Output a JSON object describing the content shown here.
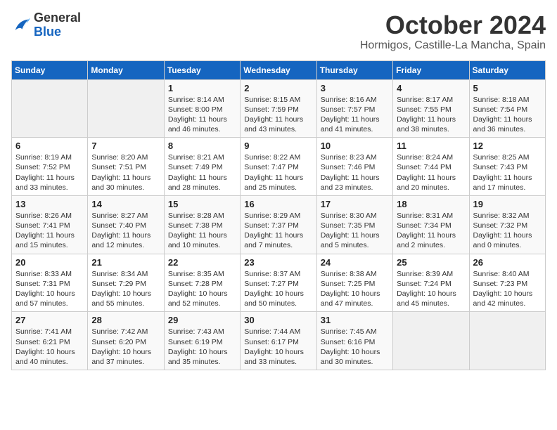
{
  "logo": {
    "general": "General",
    "blue": "Blue"
  },
  "title": "October 2024",
  "location": "Hormigos, Castille-La Mancha, Spain",
  "days_of_week": [
    "Sunday",
    "Monday",
    "Tuesday",
    "Wednesday",
    "Thursday",
    "Friday",
    "Saturday"
  ],
  "weeks": [
    [
      {
        "day": "",
        "info": ""
      },
      {
        "day": "",
        "info": ""
      },
      {
        "day": "1",
        "info": "Sunrise: 8:14 AM\nSunset: 8:00 PM\nDaylight: 11 hours and 46 minutes."
      },
      {
        "day": "2",
        "info": "Sunrise: 8:15 AM\nSunset: 7:59 PM\nDaylight: 11 hours and 43 minutes."
      },
      {
        "day": "3",
        "info": "Sunrise: 8:16 AM\nSunset: 7:57 PM\nDaylight: 11 hours and 41 minutes."
      },
      {
        "day": "4",
        "info": "Sunrise: 8:17 AM\nSunset: 7:55 PM\nDaylight: 11 hours and 38 minutes."
      },
      {
        "day": "5",
        "info": "Sunrise: 8:18 AM\nSunset: 7:54 PM\nDaylight: 11 hours and 36 minutes."
      }
    ],
    [
      {
        "day": "6",
        "info": "Sunrise: 8:19 AM\nSunset: 7:52 PM\nDaylight: 11 hours and 33 minutes."
      },
      {
        "day": "7",
        "info": "Sunrise: 8:20 AM\nSunset: 7:51 PM\nDaylight: 11 hours and 30 minutes."
      },
      {
        "day": "8",
        "info": "Sunrise: 8:21 AM\nSunset: 7:49 PM\nDaylight: 11 hours and 28 minutes."
      },
      {
        "day": "9",
        "info": "Sunrise: 8:22 AM\nSunset: 7:47 PM\nDaylight: 11 hours and 25 minutes."
      },
      {
        "day": "10",
        "info": "Sunrise: 8:23 AM\nSunset: 7:46 PM\nDaylight: 11 hours and 23 minutes."
      },
      {
        "day": "11",
        "info": "Sunrise: 8:24 AM\nSunset: 7:44 PM\nDaylight: 11 hours and 20 minutes."
      },
      {
        "day": "12",
        "info": "Sunrise: 8:25 AM\nSunset: 7:43 PM\nDaylight: 11 hours and 17 minutes."
      }
    ],
    [
      {
        "day": "13",
        "info": "Sunrise: 8:26 AM\nSunset: 7:41 PM\nDaylight: 11 hours and 15 minutes."
      },
      {
        "day": "14",
        "info": "Sunrise: 8:27 AM\nSunset: 7:40 PM\nDaylight: 11 hours and 12 minutes."
      },
      {
        "day": "15",
        "info": "Sunrise: 8:28 AM\nSunset: 7:38 PM\nDaylight: 11 hours and 10 minutes."
      },
      {
        "day": "16",
        "info": "Sunrise: 8:29 AM\nSunset: 7:37 PM\nDaylight: 11 hours and 7 minutes."
      },
      {
        "day": "17",
        "info": "Sunrise: 8:30 AM\nSunset: 7:35 PM\nDaylight: 11 hours and 5 minutes."
      },
      {
        "day": "18",
        "info": "Sunrise: 8:31 AM\nSunset: 7:34 PM\nDaylight: 11 hours and 2 minutes."
      },
      {
        "day": "19",
        "info": "Sunrise: 8:32 AM\nSunset: 7:32 PM\nDaylight: 11 hours and 0 minutes."
      }
    ],
    [
      {
        "day": "20",
        "info": "Sunrise: 8:33 AM\nSunset: 7:31 PM\nDaylight: 10 hours and 57 minutes."
      },
      {
        "day": "21",
        "info": "Sunrise: 8:34 AM\nSunset: 7:29 PM\nDaylight: 10 hours and 55 minutes."
      },
      {
        "day": "22",
        "info": "Sunrise: 8:35 AM\nSunset: 7:28 PM\nDaylight: 10 hours and 52 minutes."
      },
      {
        "day": "23",
        "info": "Sunrise: 8:37 AM\nSunset: 7:27 PM\nDaylight: 10 hours and 50 minutes."
      },
      {
        "day": "24",
        "info": "Sunrise: 8:38 AM\nSunset: 7:25 PM\nDaylight: 10 hours and 47 minutes."
      },
      {
        "day": "25",
        "info": "Sunrise: 8:39 AM\nSunset: 7:24 PM\nDaylight: 10 hours and 45 minutes."
      },
      {
        "day": "26",
        "info": "Sunrise: 8:40 AM\nSunset: 7:23 PM\nDaylight: 10 hours and 42 minutes."
      }
    ],
    [
      {
        "day": "27",
        "info": "Sunrise: 7:41 AM\nSunset: 6:21 PM\nDaylight: 10 hours and 40 minutes."
      },
      {
        "day": "28",
        "info": "Sunrise: 7:42 AM\nSunset: 6:20 PM\nDaylight: 10 hours and 37 minutes."
      },
      {
        "day": "29",
        "info": "Sunrise: 7:43 AM\nSunset: 6:19 PM\nDaylight: 10 hours and 35 minutes."
      },
      {
        "day": "30",
        "info": "Sunrise: 7:44 AM\nSunset: 6:17 PM\nDaylight: 10 hours and 33 minutes."
      },
      {
        "day": "31",
        "info": "Sunrise: 7:45 AM\nSunset: 6:16 PM\nDaylight: 10 hours and 30 minutes."
      },
      {
        "day": "",
        "info": ""
      },
      {
        "day": "",
        "info": ""
      }
    ]
  ]
}
